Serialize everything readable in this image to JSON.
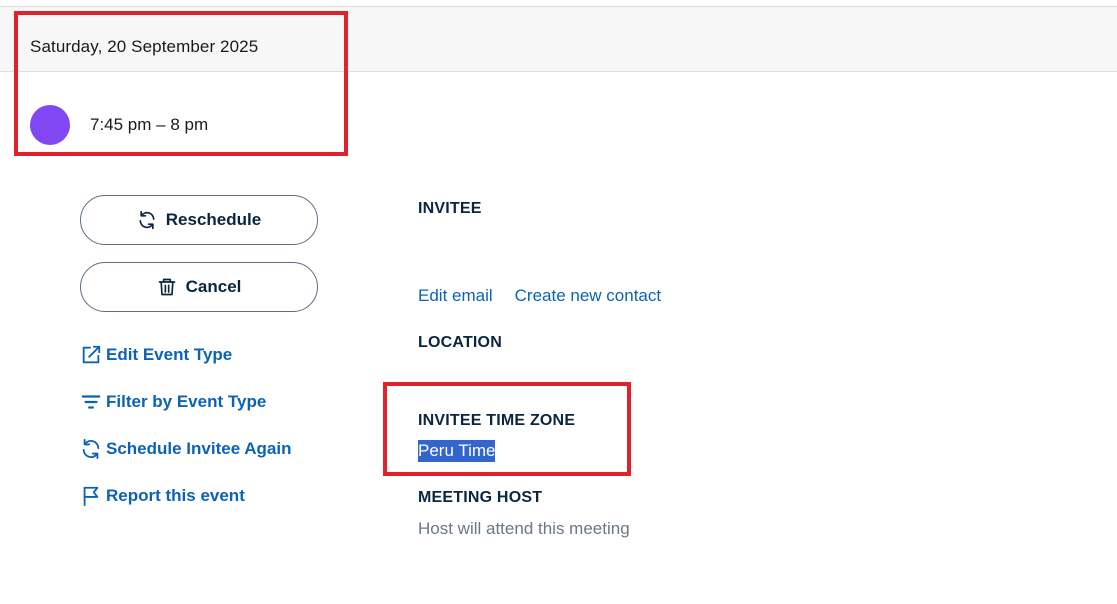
{
  "header": {
    "date": "Saturday, 20 September 2025",
    "time_range": "7:45 pm – 8 pm",
    "event_color": "#8247f5"
  },
  "actions": {
    "reschedule_label": "Reschedule",
    "cancel_label": "Cancel",
    "links": {
      "edit_event_type": "Edit Event Type",
      "filter_by_event_type": "Filter by Event Type",
      "schedule_invitee_again": "Schedule Invitee Again",
      "report_event": "Report this event"
    }
  },
  "details": {
    "invitee_label": "INVITEE",
    "edit_email": "Edit email",
    "create_new_contact": "Create new contact",
    "location_label": "LOCATION",
    "timezone_label": "INVITEE TIME ZONE",
    "timezone_value": "Peru Time",
    "host_label": "MEETING HOST",
    "host_note": "Host will attend this meeting"
  },
  "colors": {
    "link": "#0b63b6",
    "annotation": "#e0222b",
    "selection": "#3366cc"
  }
}
